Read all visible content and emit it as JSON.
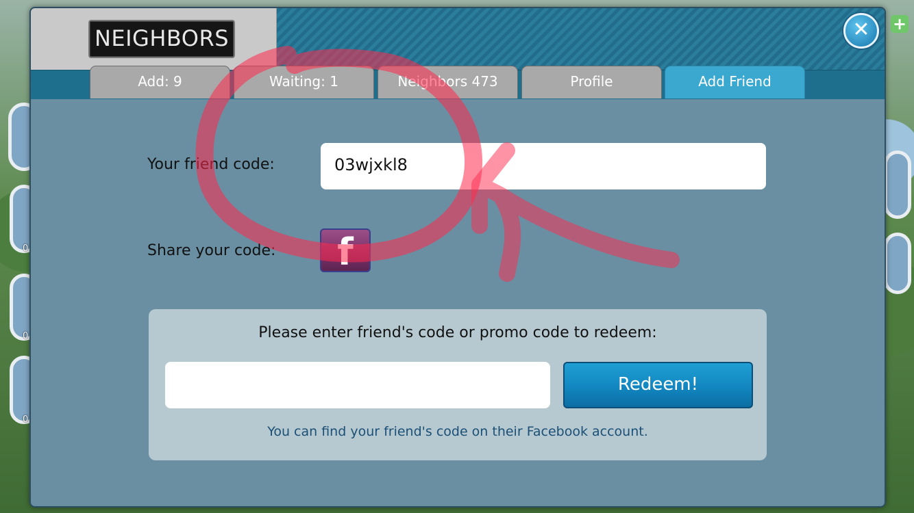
{
  "dialog": {
    "title": "NEIGHBORS",
    "close_icon": "close-icon"
  },
  "tabs": [
    {
      "label": "Add: 9"
    },
    {
      "label": "Waiting: 1"
    },
    {
      "label": "Neighbors 473"
    },
    {
      "label": "Profile"
    },
    {
      "label": "Add Friend",
      "active": true
    }
  ],
  "friend_code": {
    "label": "Your friend code:",
    "value": "03wjxkl8"
  },
  "share": {
    "label": "Share your code:",
    "icon": "facebook-icon",
    "glyph": "f"
  },
  "redeem": {
    "prompt": "Please enter friend's code or promo code to redeem:",
    "input_value": "",
    "button_label": "Redeem!",
    "hint": "You can find your friend's code on their Facebook account."
  },
  "background_counts": [
    "0",
    "0",
    "0",
    "0"
  ],
  "colors": {
    "active_tab": "#3ba8cf",
    "inactive_tab": "#a9a9a9",
    "redeem_button": "#1286c0",
    "annotation": "#ff2a4d"
  }
}
